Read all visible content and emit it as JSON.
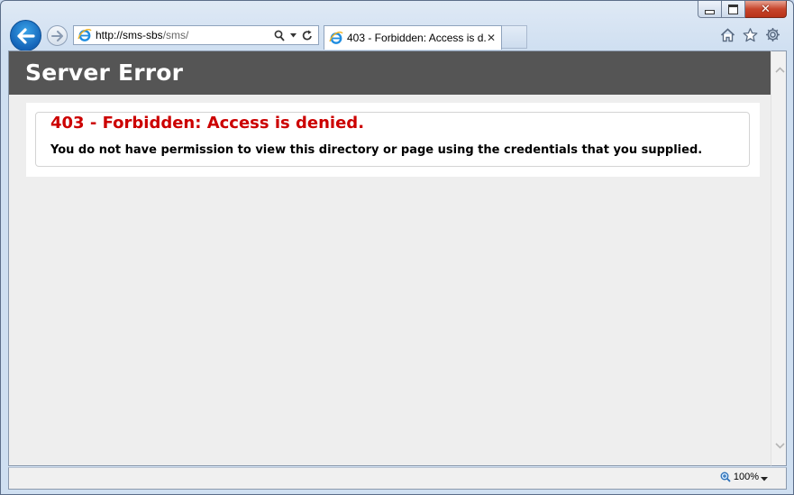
{
  "window": {
    "minimize_glyph": "minimize",
    "maximize_glyph": "maximize",
    "close_glyph": "close"
  },
  "nav": {
    "url_host": "http://sms-sbs",
    "url_path": "/sms/"
  },
  "tab": {
    "title": "403 - Forbidden: Access is d...",
    "close": "✕"
  },
  "page": {
    "header": "Server Error",
    "error_title": "403 - Forbidden: Access is denied.",
    "error_message": "You do not have permission to view this directory or page using the credentials that you supplied."
  },
  "status": {
    "zoom": "100%"
  },
  "colors": {
    "header_bg": "#555555",
    "error_red": "#cc0000",
    "page_bg": "#eeeeee"
  },
  "icons": [
    "back-arrow-icon",
    "forward-arrow-icon",
    "ie-logo-icon",
    "search-icon",
    "dropdown-icon",
    "refresh-icon",
    "home-icon",
    "favorites-star-icon",
    "settings-gear-icon",
    "zoom-icon"
  ]
}
